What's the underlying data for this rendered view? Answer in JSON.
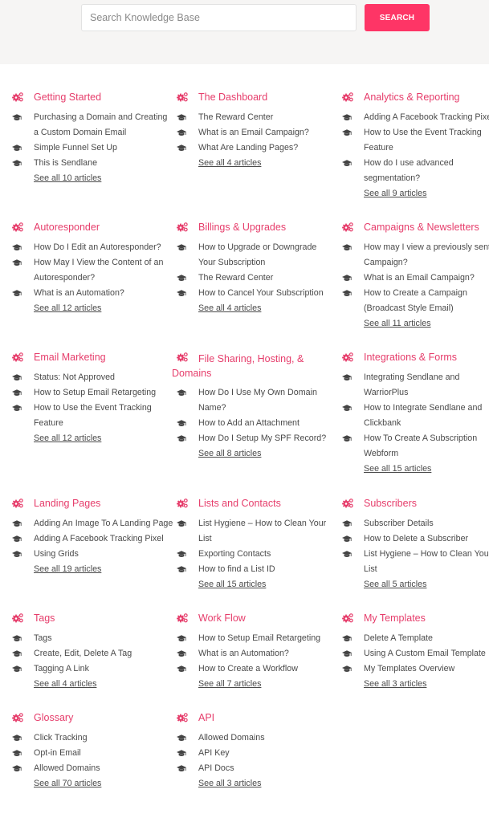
{
  "search": {
    "placeholder": "Search Knowledge Base",
    "button_label": "SEARCH"
  },
  "colors": {
    "accent": "#fe3566",
    "category_title": "#e63d6b",
    "hero_bg": "#f6f5f4",
    "text": "#4a4a4a"
  },
  "icons": {
    "category": "gears-icon",
    "article": "graduation-cap-icon"
  },
  "categories": [
    {
      "title": "Getting Started",
      "articles": [
        [
          "Purchasing a Domain and Creating",
          "a Custom Domain Email"
        ],
        [
          "Simple Funnel Set Up"
        ],
        [
          "This is Sendlane"
        ]
      ],
      "see_all": "See all 10 articles"
    },
    {
      "title": "The Dashboard",
      "articles": [
        [
          "The Reward Center"
        ],
        [
          "What is an Email Campaign?"
        ],
        [
          "What Are Landing Pages?"
        ]
      ],
      "see_all": "See all 4 articles"
    },
    {
      "title": "Analytics & Reporting",
      "articles": [
        [
          "Adding A Facebook Tracking Pixel"
        ],
        [
          "How to Use the Event Tracking",
          "Feature"
        ],
        [
          "How do I use advanced",
          "segmentation?"
        ]
      ],
      "see_all": "See all 9 articles"
    },
    {
      "title": "Autoresponder",
      "articles": [
        [
          "How Do I Edit an Autoresponder?"
        ],
        [
          "How May I View the Content of an",
          "Autoresponder?"
        ],
        [
          "What is an Automation?"
        ]
      ],
      "see_all": "See all 12 articles"
    },
    {
      "title": "Billings & Upgrades",
      "articles": [
        [
          "How to Upgrade or Downgrade",
          "Your Subscription"
        ],
        [
          "The Reward Center"
        ],
        [
          "How to Cancel Your Subscription"
        ]
      ],
      "see_all": "See all 4 articles"
    },
    {
      "title": "Campaigns & Newsletters",
      "articles": [
        [
          "How may I view a previously sent",
          "Campaign?"
        ],
        [
          "What is an Email Campaign?"
        ],
        [
          "How to Create a Campaign",
          "(Broadcast Style Email)"
        ]
      ],
      "see_all": "See all 11 articles"
    },
    {
      "title": "Email Marketing",
      "articles": [
        [
          "Status: Not Approved"
        ],
        [
          "How to Setup Email Retargeting"
        ],
        [
          "How to Use the Event Tracking",
          "Feature"
        ]
      ],
      "see_all": "See all 12 articles"
    },
    {
      "title": "File Sharing, Hosting, & Domains",
      "articles": [
        [
          "How Do I Use My Own Domain",
          "Name?"
        ],
        [
          "How to Add an Attachment"
        ],
        [
          "How Do I Setup My SPF Record?"
        ]
      ],
      "see_all": "See all 8 articles"
    },
    {
      "title": "Integrations & Forms",
      "articles": [
        [
          "Integrating Sendlane and",
          "WarriorPlus"
        ],
        [
          "How to Integrate Sendlane and",
          "Clickbank"
        ],
        [
          "How To Create A Subscription",
          "Webform"
        ]
      ],
      "see_all": "See all 15 articles"
    },
    {
      "title": "Landing Pages",
      "articles": [
        [
          "Adding An Image To A Landing Page"
        ],
        [
          "Adding A Facebook Tracking Pixel"
        ],
        [
          "Using Grids"
        ]
      ],
      "see_all": "See all 19 articles"
    },
    {
      "title": "Lists and Contacts",
      "articles": [
        [
          "List Hygiene – How to Clean Your",
          "List"
        ],
        [
          "Exporting Contacts"
        ],
        [
          "How to find a List ID"
        ]
      ],
      "see_all": "See all 15 articles"
    },
    {
      "title": "Subscribers",
      "articles": [
        [
          "Subscriber Details"
        ],
        [
          "How to Delete a Subscriber"
        ],
        [
          "List Hygiene – How to Clean Your",
          "List"
        ]
      ],
      "see_all": "See all 5 articles"
    },
    {
      "title": "Tags",
      "articles": [
        [
          "Tags"
        ],
        [
          "Create, Edit, Delete A Tag"
        ],
        [
          "Tagging A Link"
        ]
      ],
      "see_all": "See all 4 articles"
    },
    {
      "title": "Work Flow",
      "articles": [
        [
          "How to Setup Email Retargeting"
        ],
        [
          "What is an Automation?"
        ],
        [
          "How to Create a Workflow"
        ]
      ],
      "see_all": "See all 7 articles"
    },
    {
      "title": "My Templates",
      "articles": [
        [
          "Delete A Template"
        ],
        [
          "Using A Custom Email Template"
        ],
        [
          "My Templates Overview"
        ]
      ],
      "see_all": "See all 3 articles"
    },
    {
      "title": "Glossary",
      "articles": [
        [
          "Click Tracking"
        ],
        [
          "Opt-in Email"
        ],
        [
          "Allowed Domains"
        ]
      ],
      "see_all": "See all 70 articles"
    },
    {
      "title": "API",
      "articles": [
        [
          "Allowed Domains"
        ],
        [
          "API Key"
        ],
        [
          "API Docs"
        ]
      ],
      "see_all": "See all 3 articles"
    }
  ]
}
